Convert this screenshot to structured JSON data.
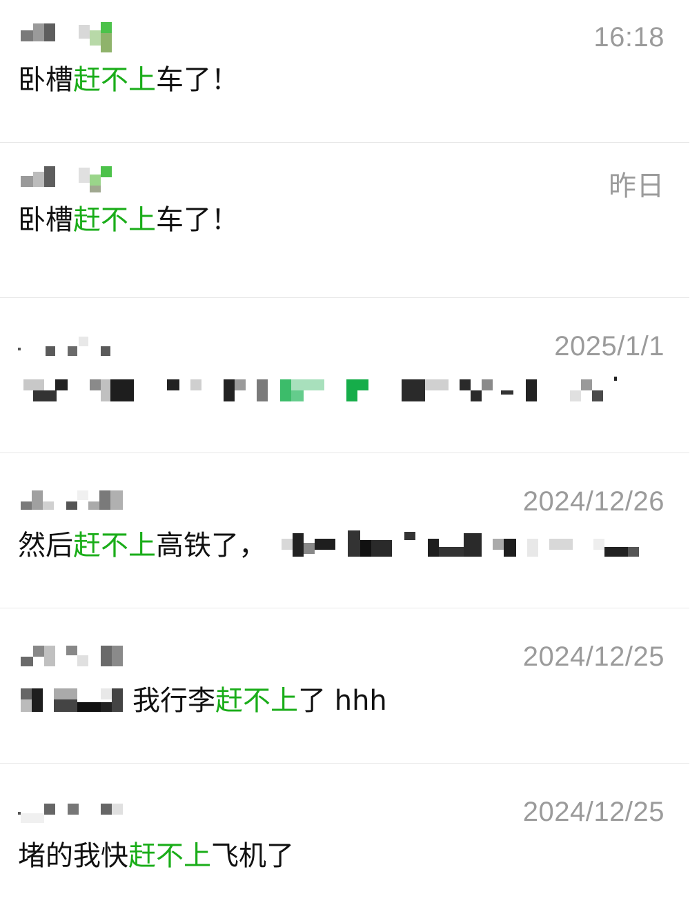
{
  "results": [
    {
      "time": "16:18",
      "message": {
        "before": "卧槽",
        "keyword": "赶不上",
        "after": "车了！"
      }
    },
    {
      "time": "昨日",
      "message": {
        "before": "卧槽",
        "keyword": "赶不上",
        "after": "车了！"
      }
    },
    {
      "time": "2025/1/1",
      "message": {
        "before": "",
        "keyword": "",
        "after": ""
      }
    },
    {
      "time": "2024/12/26",
      "message": {
        "before": "然后",
        "keyword": "赶不上",
        "after": "高铁了，"
      }
    },
    {
      "time": "2024/12/25",
      "message": {
        "before": "我行李",
        "keyword": "赶不上",
        "after": "了 hhh"
      }
    },
    {
      "time": "2024/12/25",
      "message": {
        "before": "堵的我快",
        "keyword": "赶不上",
        "after": "飞机了"
      }
    }
  ],
  "colors": {
    "keyword": "#1aad19",
    "timestamp": "#9b9b9b",
    "message": "#111111",
    "divider": "#e8e8e8"
  }
}
